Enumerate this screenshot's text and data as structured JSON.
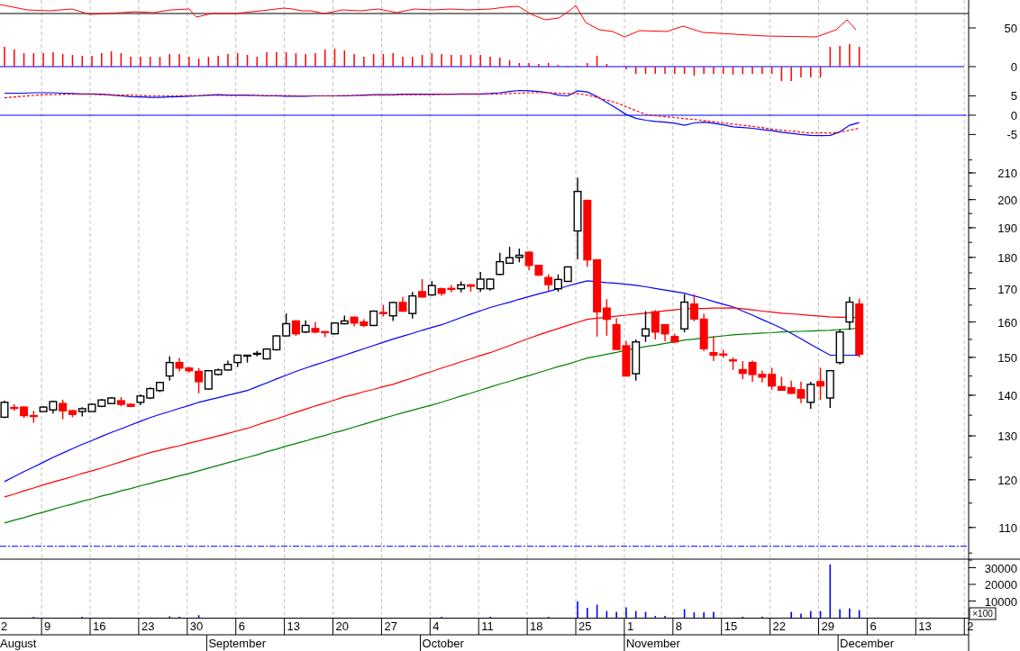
{
  "indicator_panel": {
    "label": "50"
  },
  "histogram_panel": {
    "label": "0"
  },
  "macd_panel": {
    "labels": [
      "5",
      "0",
      "-5"
    ]
  },
  "price_axis": {
    "labels": [
      "210",
      "200",
      "190",
      "180",
      "170",
      "160",
      "150",
      "140",
      "130",
      "120",
      "110"
    ]
  },
  "volume_panel": {
    "unit_label": "×100",
    "labels": [
      "30000",
      "20000",
      "10000"
    ]
  },
  "date_axis": {
    "weeks": [
      "2",
      "9",
      "16",
      "23",
      "30",
      "6",
      "13",
      "20",
      "27",
      "4",
      "11",
      "18",
      "25",
      "1",
      "8",
      "15",
      "22",
      "29",
      "6",
      "13",
      "2"
    ],
    "months": [
      "August",
      "September",
      "October",
      "November",
      "December"
    ]
  }
}
